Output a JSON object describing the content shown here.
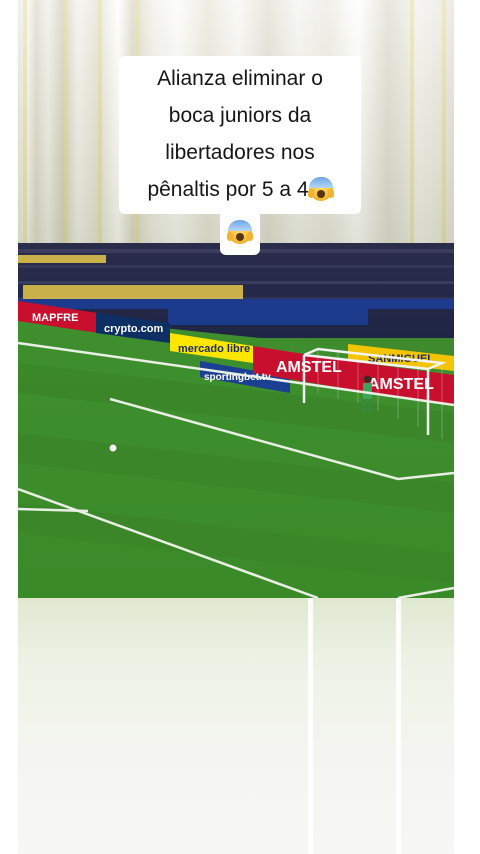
{
  "caption": {
    "lines": [
      "Alianza eliminar o",
      "boca juniors da",
      "libertadores nos",
      "pênaltis por 5 a 4"
    ],
    "emoji_icon": "face-screaming-in-fear"
  },
  "video": {
    "banners": [
      {
        "text": "MAPFRE",
        "color": "#c8102e"
      },
      {
        "text": "crypto.com",
        "color": "#0b2a5a"
      },
      {
        "text": "mercado libre",
        "color": "#ffe600"
      },
      {
        "text": "AMSTEL",
        "color": "#c8102e"
      },
      {
        "text": "sportingbet.tv",
        "color": "#ffffff"
      },
      {
        "text": "AMSTEL",
        "color": "#c8102e"
      },
      {
        "text": "SANMIGUEL",
        "color": "#f2c500"
      }
    ]
  }
}
